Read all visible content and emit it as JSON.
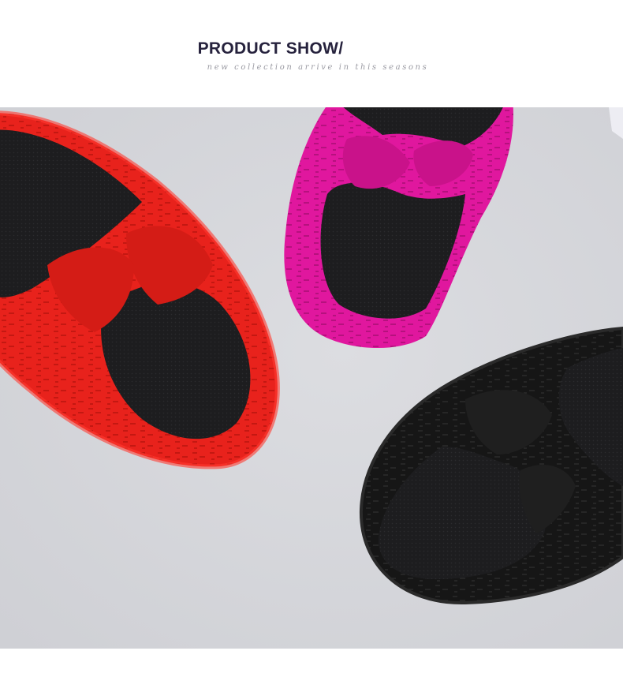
{
  "header": {
    "title": "PRODUCT SHOW/",
    "subtitle": "new collection arrive in this seasons"
  },
  "product_photo": {
    "items": [
      {
        "color": "#e8221c",
        "icon": "red-slipper"
      },
      {
        "color": "#e0179e",
        "icon": "pink-slipper"
      },
      {
        "color": "#141414",
        "icon": "black-slipper"
      }
    ],
    "background": "#d4d5d9"
  }
}
